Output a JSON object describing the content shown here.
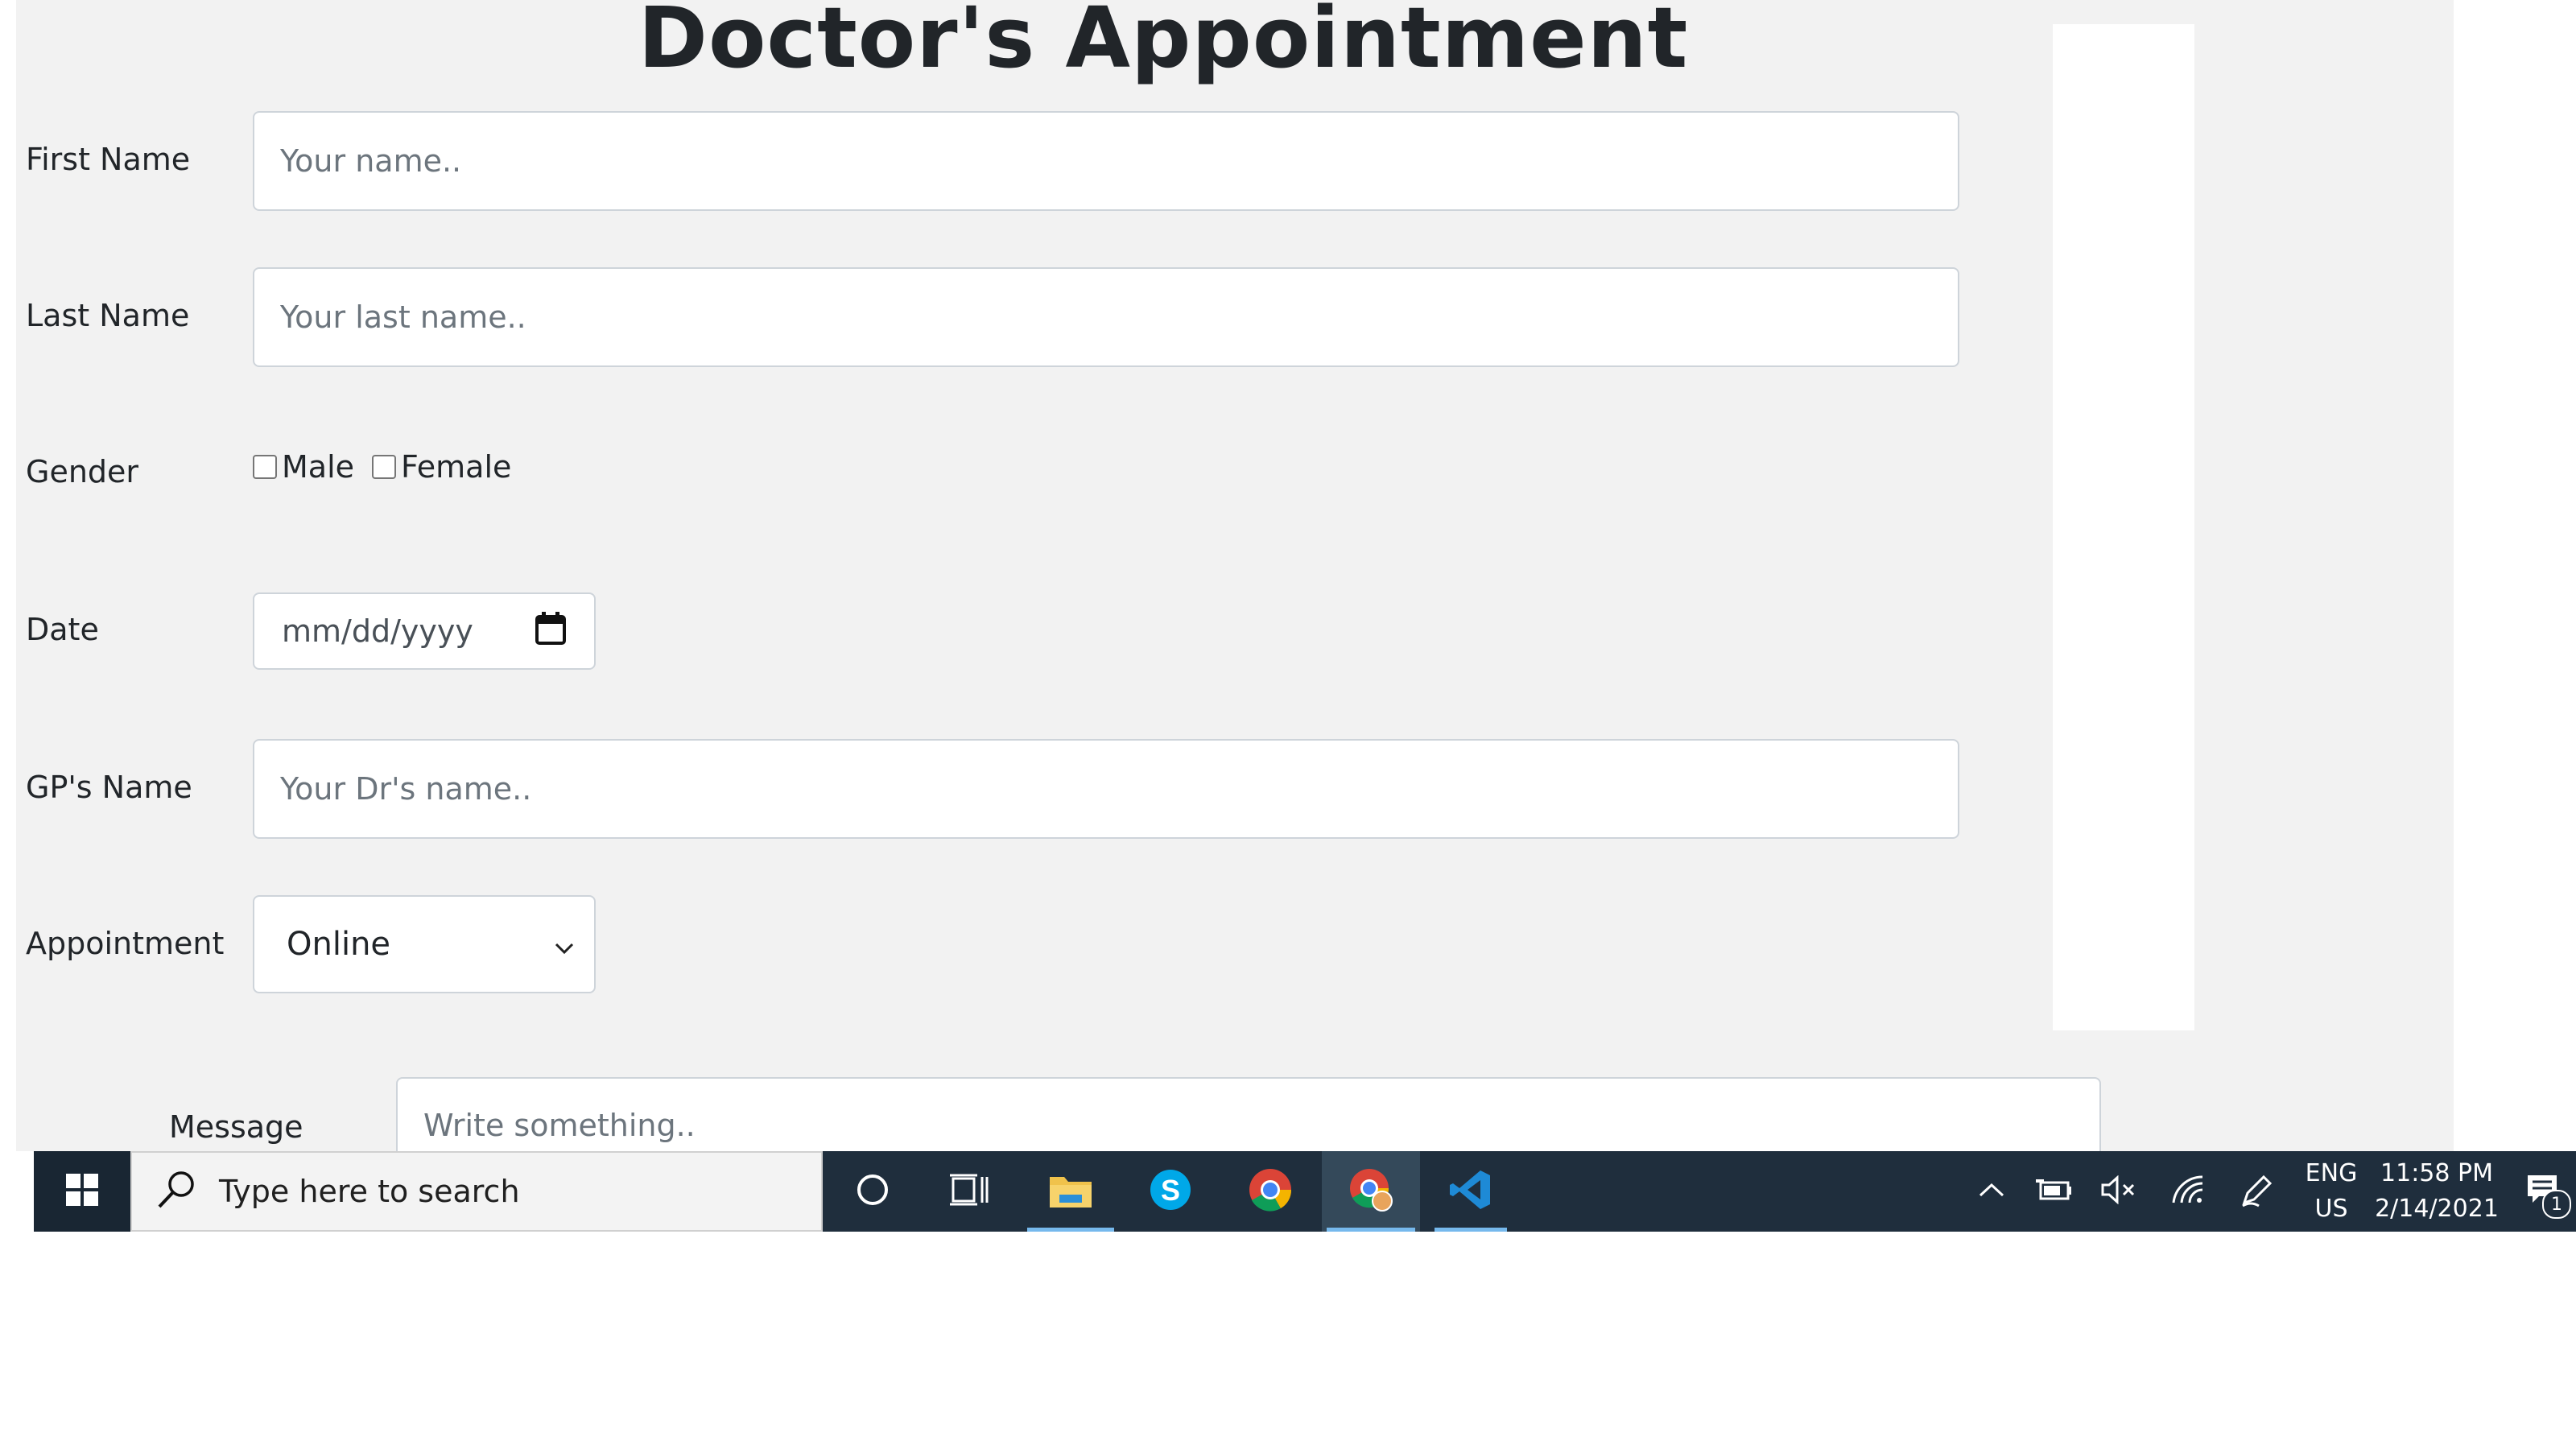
{
  "form": {
    "title": "Doctor's Appointment",
    "first_name": {
      "label": "First Name",
      "placeholder": "Your name.."
    },
    "last_name": {
      "label": "Last Name",
      "placeholder": "Your last name.."
    },
    "gender": {
      "label": "Gender",
      "options": [
        "Male",
        "Female"
      ]
    },
    "date": {
      "label": "Date",
      "placeholder": "mm/dd/yyyy"
    },
    "gp_name": {
      "label": "GP's Name",
      "placeholder": "Your Dr's name.."
    },
    "appointment": {
      "label": "Appointment",
      "selected": "Online"
    },
    "message": {
      "label": "Message",
      "placeholder": "Write something.."
    }
  },
  "taskbar": {
    "search_placeholder": "Type here to search",
    "language": {
      "line1": "ENG",
      "line2": "US"
    },
    "clock": {
      "time": "11:58 PM",
      "date": "2/14/2021"
    },
    "notification_count": "1",
    "pinned_icons": [
      "cortana-icon",
      "task-view-icon",
      "file-explorer-icon",
      "skype-icon",
      "chrome-icon",
      "chrome-profile-icon",
      "vscode-icon"
    ],
    "colors": {
      "taskbar": "#1f2e3d",
      "active_underline": "#76b9ed"
    }
  }
}
